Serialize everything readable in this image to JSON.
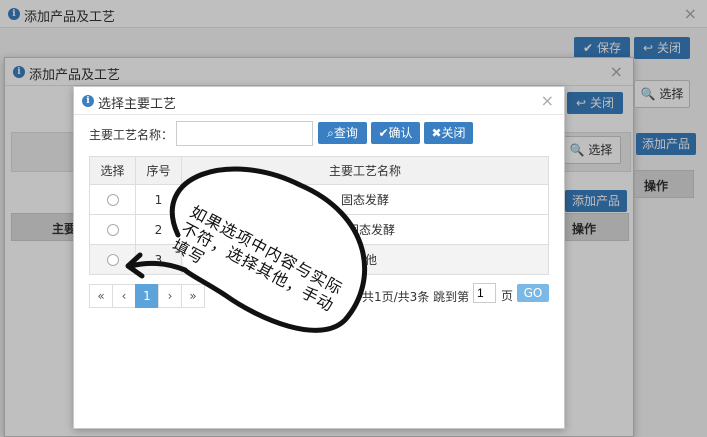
{
  "back_window": {
    "title": "添加产品及工艺",
    "save_label": "保存",
    "close_label": "关闭",
    "close_x": "×"
  },
  "mid_window": {
    "title": "添加产品及工艺",
    "close_x": "×",
    "close_label": "关闭",
    "select_label": "选择",
    "select_label2": "选择",
    "add_product_label": "添加产品",
    "add_product_label2": "添加产品",
    "col_main": "主要",
    "col_op": "操作",
    "col_op2": "操作"
  },
  "dialog": {
    "title": "选择主要工艺",
    "close_x": "×",
    "search_label": "主要工艺名称：",
    "search_value": "",
    "query_label": "查询",
    "confirm_label": "确认",
    "close_label": "关闭",
    "columns": [
      "选择",
      "序号",
      "主要工艺名称"
    ],
    "rows": [
      {
        "no": "1",
        "name": "固态发酵"
      },
      {
        "no": "2",
        "name": "半固态发酵"
      },
      {
        "no": "3",
        "name": "其他"
      }
    ],
    "pager": {
      "first": "«",
      "prev": "‹",
      "current": "1",
      "next": "›",
      "last": "»",
      "summary": "共1页/共3条 跳到第",
      "page_input": "1",
      "page_unit": "页",
      "go": "GO"
    }
  },
  "annotation": {
    "text": "如果选项中内容与实际不符，选择其他，手动填写"
  },
  "colors": {
    "primary": "#3a7fc1",
    "pager_active": "#5ba3d9",
    "go": "#7ab8e6"
  }
}
